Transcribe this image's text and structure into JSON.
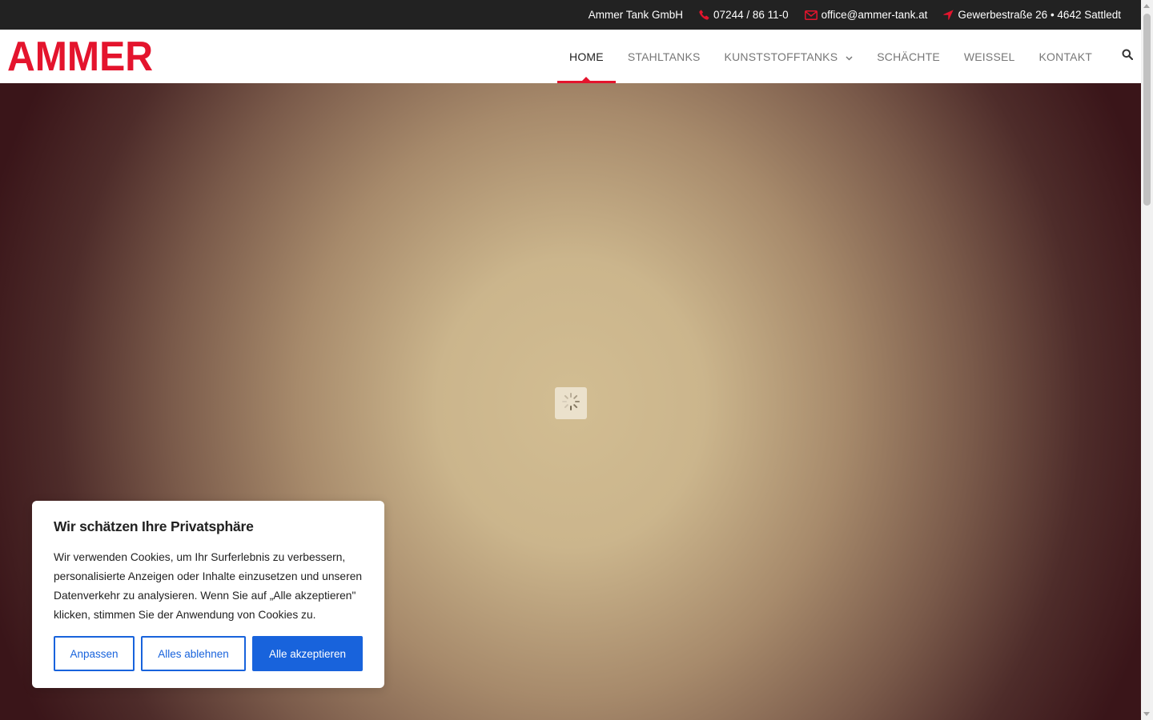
{
  "topbar": {
    "company": "Ammer Tank GmbH",
    "phone": "07244 / 86 11-0",
    "email": "office@ammer-tank.at",
    "address": "Gewerbestraße 26 • 4642 Sattledt"
  },
  "header": {
    "logo_text": "AMMER",
    "nav": [
      {
        "label": "HOME",
        "active": true
      },
      {
        "label": "STAHLTANKS"
      },
      {
        "label": "KUNSTSTOFFTANKS",
        "has_submenu": true
      },
      {
        "label": "SCHÄCHTE"
      },
      {
        "label": "WEIßEL"
      },
      {
        "label": "KONTAKT"
      }
    ]
  },
  "cookie": {
    "title": "Wir schätzen Ihre Privatsphäre",
    "text": "Wir verwenden Cookies, um Ihr Surferlebnis zu verbessern, personalisierte Anzeigen oder Inhalte einzusetzen und unseren Datenverkehr zu analysieren. Wenn Sie auf „Alle akzeptieren\" klicken, stimmen Sie der Anwendung von Cookies zu.",
    "customize_label": "Anpassen",
    "reject_label": "Alles ablehnen",
    "accept_label": "Alle akzeptieren"
  },
  "colors": {
    "brand_red": "#e4142d",
    "topbar_bg": "#222222",
    "cookie_blue": "#1863dc"
  },
  "icons": {
    "phone": "phone-icon",
    "email": "envelope-icon",
    "address": "location-arrow-icon",
    "search": "search-icon",
    "loader": "spinner-icon"
  }
}
